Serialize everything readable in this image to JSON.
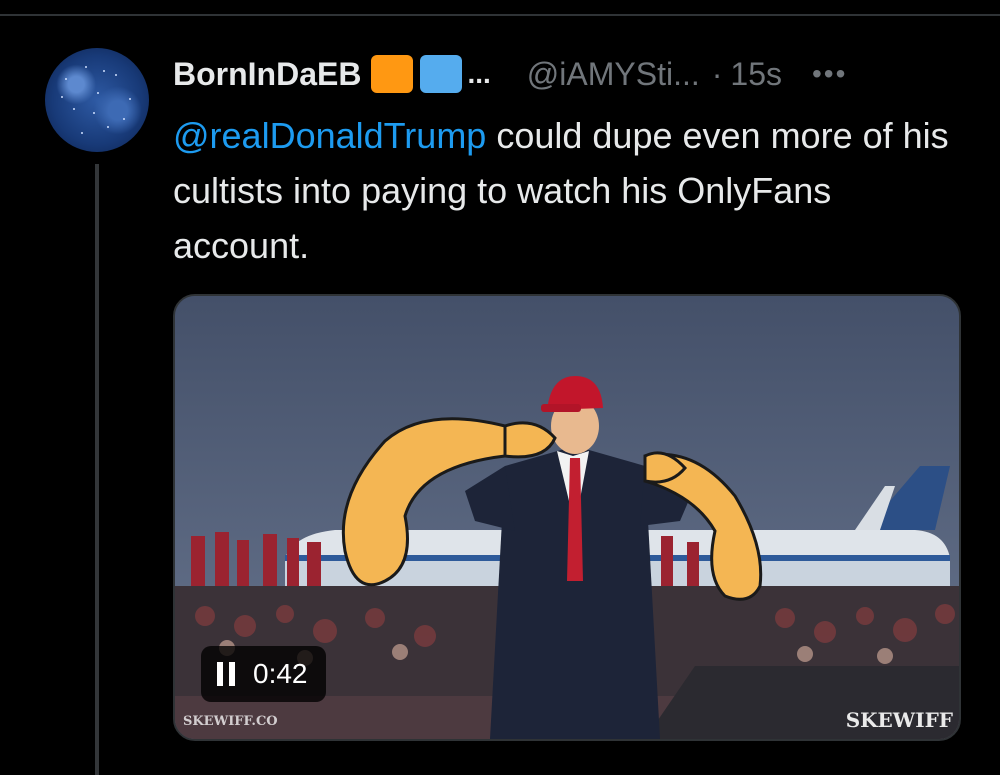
{
  "author": {
    "display_name": "BornInDaEB",
    "badges": [
      {
        "icon": "orange-square-icon",
        "color": "#ff9812"
      },
      {
        "icon": "blue-square-icon",
        "color": "#55acee"
      }
    ],
    "name_overflow": "...",
    "handle": "@iAMYSti...",
    "separator": "·",
    "timestamp": "15s",
    "more_label": "•••"
  },
  "tweet": {
    "mention": "@realDonaldTrump",
    "body": " could dupe even more of his cultists into paying to watch his OnlyFans account."
  },
  "video": {
    "time": "0:42",
    "state": "playing",
    "watermark_left": "SKEWIFF.CO",
    "watermark_right": "SKEWIFF"
  },
  "colors": {
    "background": "#000000",
    "text": "#e7e9ea",
    "secondary": "#71767b",
    "link": "#1d9bf0"
  }
}
